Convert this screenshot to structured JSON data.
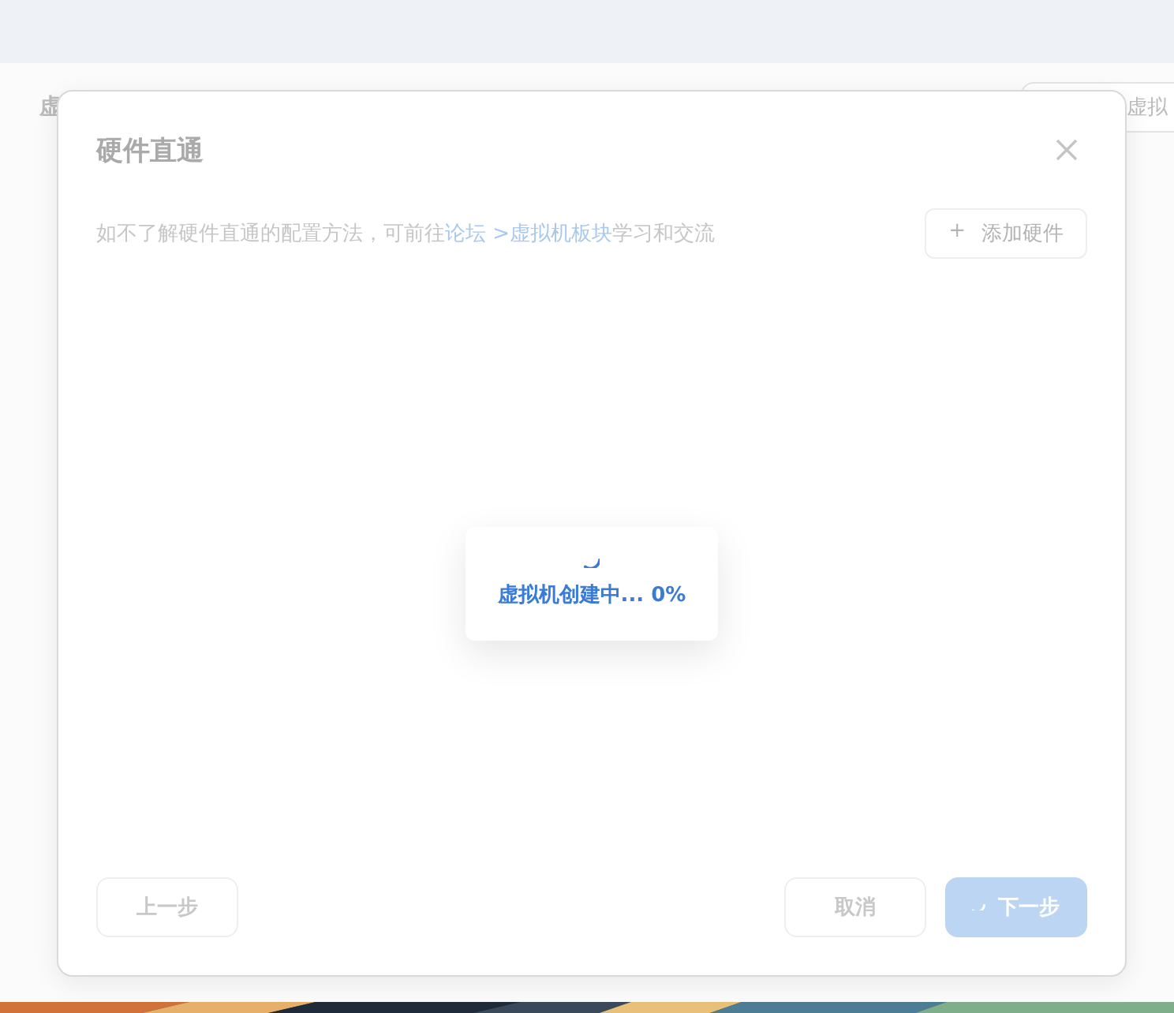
{
  "page": {
    "header_title": "虚",
    "header_button": "虚拟"
  },
  "dialog": {
    "title": "硬件直通",
    "hint": {
      "before": "如不了解硬件直通的配置方法，可前往",
      "link": "论坛 >虚拟机板块",
      "after": "学习和交流"
    },
    "add_button": {
      "icon": "+",
      "label": "添加硬件"
    },
    "loading": {
      "text": "虚拟机创建中... 0%"
    },
    "buttons": [
      {
        "kind": "prev",
        "label": "上一步",
        "loading": false
      },
      {
        "kind": "cancel",
        "label": "取消",
        "loading": false
      },
      {
        "kind": "next",
        "label": "下一步",
        "loading": true
      }
    ]
  }
}
